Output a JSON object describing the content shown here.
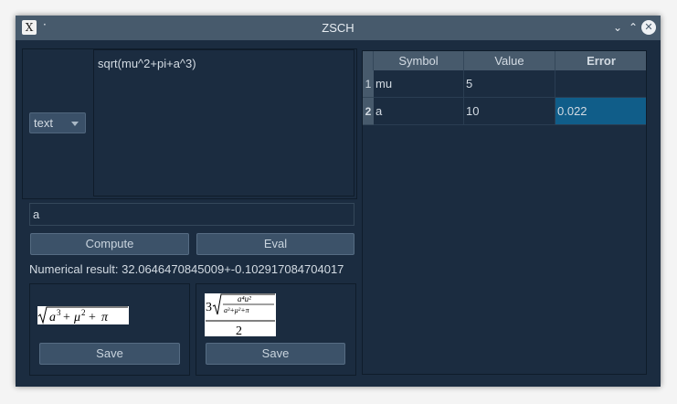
{
  "window": {
    "title": "ZSCH",
    "app_icon_glyph": "X",
    "menu_glyph": "·",
    "controls": {
      "minimize": "⌄",
      "maximize": "⌃",
      "close": "✕"
    }
  },
  "input_mode": {
    "selected": "text"
  },
  "expression": "sqrt(mu^2+pi+a^3)",
  "variable_input": "a",
  "buttons": {
    "compute": "Compute",
    "eval": "Eval",
    "save_left": "Save",
    "save_right": "Save"
  },
  "result": "Numerical result: 32.0646470845009+-0.102917084704017",
  "table": {
    "columns": [
      "Symbol",
      "Value",
      "Error"
    ],
    "rows": [
      {
        "num": "1",
        "symbol": "mu",
        "value": "5",
        "error": ""
      },
      {
        "num": "2",
        "symbol": "a",
        "value": "10",
        "error": "0.022"
      }
    ]
  },
  "colors": {
    "window_bg": "#1b2c40",
    "titlebar": "#475a6c",
    "selection": "#105d89",
    "button": "#3c5269"
  }
}
